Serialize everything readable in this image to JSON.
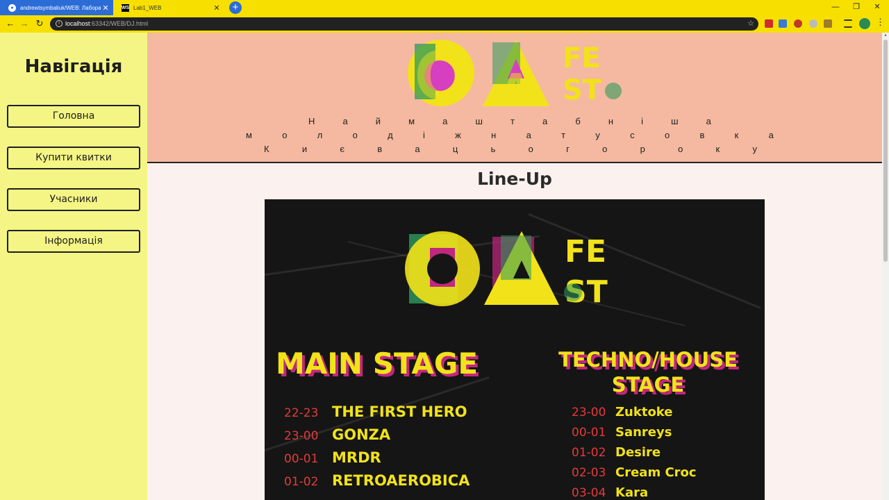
{
  "browser": {
    "tabs": [
      {
        "title": "andrewtsymbaliuk/WEB: Лаборат",
        "favicon": "github-icon"
      },
      {
        "title": "Lab1_WEB",
        "favicon": "webstorm-icon"
      }
    ],
    "url_host": "localhost",
    "url_path": ":63342/WEB/DJ.html"
  },
  "sidebar": {
    "title": "Навігація",
    "links": [
      "Головна",
      "Купити квитки",
      "Учасники",
      "Інформація"
    ]
  },
  "header": {
    "logo_letters": {
      "O": "O",
      "A": "A",
      "fe": "FE",
      "st": "ST"
    },
    "tagline_lines": [
      [
        "Н",
        "а",
        "й",
        "м",
        "а",
        "ш",
        "т",
        "а",
        "б",
        "н",
        "і",
        "ш",
        "а"
      ],
      [
        "м",
        "о",
        "л",
        "о",
        "д",
        "і",
        "ж",
        "н",
        "а",
        "т",
        "у",
        "с",
        "о",
        "в",
        "к",
        "а"
      ],
      [
        "К",
        "и",
        "є",
        "в",
        "а",
        "ц",
        "ь",
        "о",
        "г",
        "о",
        "р",
        "о",
        "к",
        "у"
      ]
    ]
  },
  "lineup": {
    "title": "Line-Up",
    "poster": {
      "main_stage_title": "MAIN STAGE",
      "techno_stage_title_1": "TECHNO/HOUSE",
      "techno_stage_title_2": "STAGE",
      "main_stage": [
        {
          "time": "22-23",
          "artist": "THE FIRST HERO"
        },
        {
          "time": "23-00",
          "artist": "GONZA"
        },
        {
          "time": "00-01",
          "artist": "MRDR"
        },
        {
          "time": "01-02",
          "artist": "RETROAEROBICA"
        }
      ],
      "techno_stage": [
        {
          "time": "23-00",
          "artist": "Zuktoke"
        },
        {
          "time": "00-01",
          "artist": "Sanreys"
        },
        {
          "time": "01-02",
          "artist": "Desire"
        },
        {
          "time": "02-03",
          "artist": "Cream Croc"
        },
        {
          "time": "03-04",
          "artist": "Kara"
        }
      ]
    }
  },
  "colors": {
    "sidebar_bg": "#f4f584",
    "header_bg": "#f4b9a0",
    "poster_yellow": "#f2e21a",
    "poster_magenta": "#c2277f",
    "poster_green": "#2e9a5c",
    "chrome_yellow": "#f7e000"
  }
}
